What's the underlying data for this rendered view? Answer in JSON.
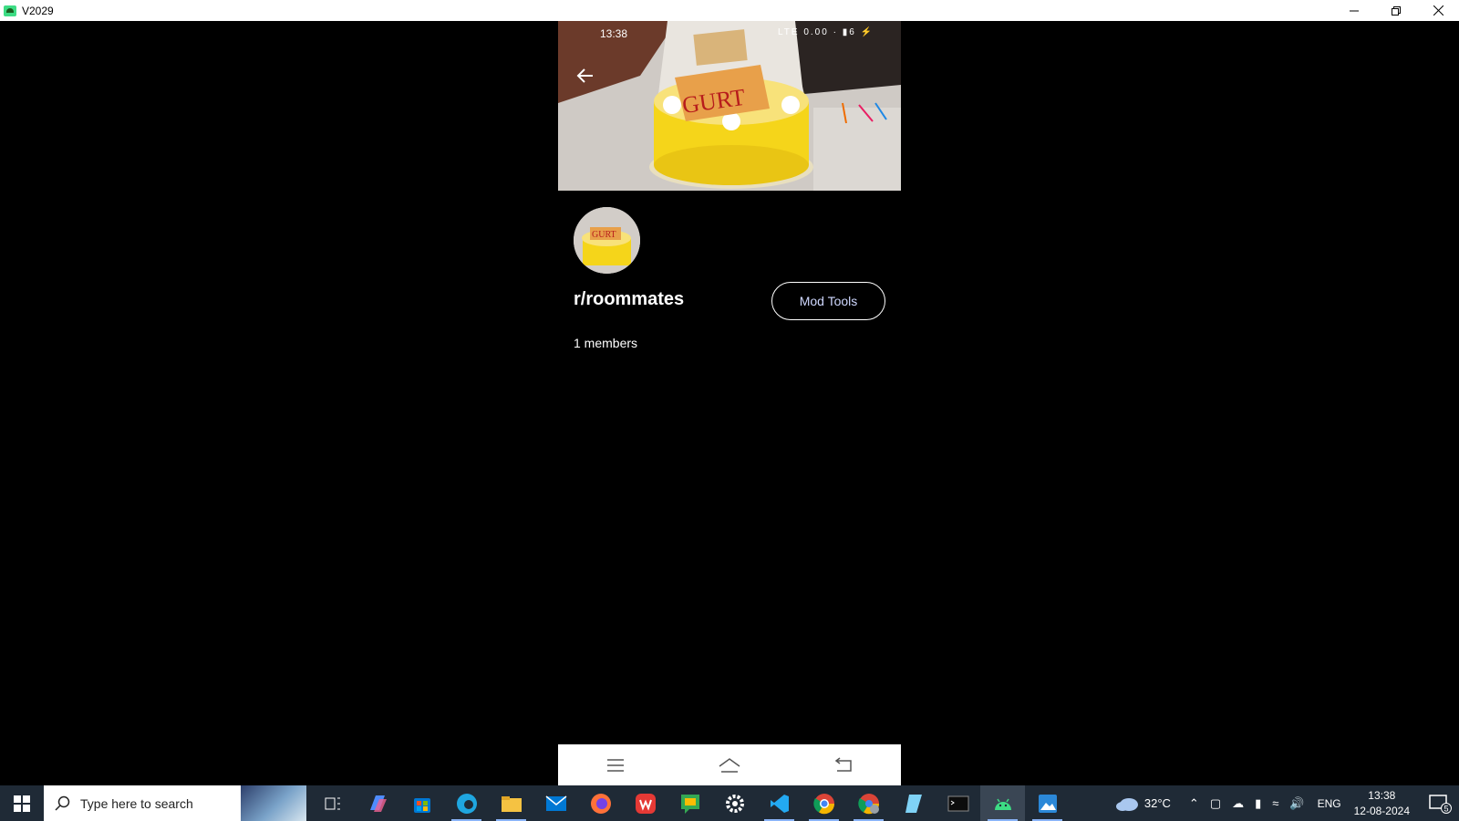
{
  "window": {
    "title": "V2029",
    "controls": [
      "minimize-icon",
      "restore-icon",
      "close-icon"
    ]
  },
  "phone": {
    "status_bar": {
      "time": "13:38",
      "right_icons_text": "LTE 0.00 · ▮6 ⚡"
    },
    "community": {
      "name": "r/roommates",
      "mod_tools_label": "Mod Tools",
      "members_text": "1 members"
    }
  },
  "taskbar": {
    "search_placeholder": "Type here to search",
    "weather_temp": "32°C",
    "language": "ENG",
    "clock_time": "13:38",
    "clock_date": "12-08-2024",
    "notification_count": "5"
  },
  "colors": {
    "accent_blue": "#cfd8ff",
    "taskbar_bg": "#1f2a36"
  }
}
